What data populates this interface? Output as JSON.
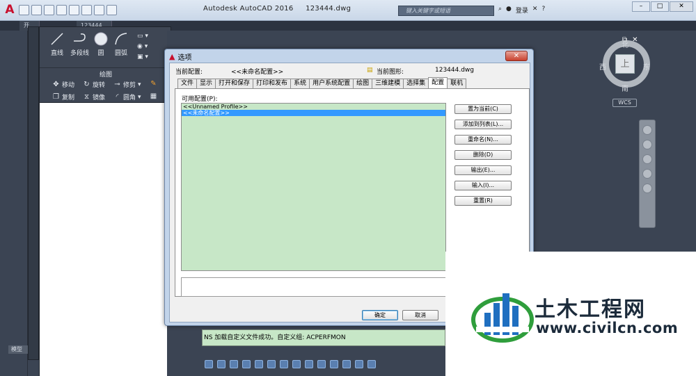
{
  "app": {
    "title_product": "Autodesk AutoCAD 2016",
    "title_file": "123444.dwg",
    "search_placeholder": "键入关键字或短语",
    "login_label": "登录"
  },
  "doc_tabs": [
    {
      "label": "开..."
    },
    {
      "label": "123444..."
    }
  ],
  "left_strip": {
    "model_tab": "模型"
  },
  "ribbon": {
    "draw_tools": [
      {
        "label": "直线"
      },
      {
        "label": "多段线"
      },
      {
        "label": "圆"
      },
      {
        "label": "圆弧"
      }
    ],
    "draw_panel_label": "绘图",
    "modify_tools": [
      {
        "label": "移动"
      },
      {
        "label": "旋转"
      },
      {
        "label": "修剪"
      },
      {
        "label": "复制"
      },
      {
        "label": "镜像"
      },
      {
        "label": "圆角"
      }
    ]
  },
  "view_cube": {
    "top_face": "上",
    "north": "北",
    "south": "南",
    "east": "东",
    "west": "西",
    "wcs_label": "WCS"
  },
  "dialog": {
    "title": "选项",
    "current_profile_label": "当前配置:",
    "current_profile_value": "<<未命名配置>>",
    "current_drawing_label": "当前图形:",
    "current_drawing_value": "123444.dwg",
    "tabs": [
      {
        "label": "文件",
        "active": false
      },
      {
        "label": "显示",
        "active": false
      },
      {
        "label": "打开和保存",
        "active": false
      },
      {
        "label": "打印和发布",
        "active": false
      },
      {
        "label": "系统",
        "active": false
      },
      {
        "label": "用户系统配置",
        "active": false
      },
      {
        "label": "绘图",
        "active": false
      },
      {
        "label": "三维建模",
        "active": false
      },
      {
        "label": "选择集",
        "active": false
      },
      {
        "label": "配置",
        "active": true
      },
      {
        "label": "联机",
        "active": false
      }
    ],
    "available_profiles_label": "可用配置(P):",
    "profiles": [
      {
        "label": "<<Unnamed Profile>>",
        "selected": false
      },
      {
        "label": "<<未命名配置>>",
        "selected": true
      }
    ],
    "side_buttons": [
      {
        "label": "置为当前(C)"
      },
      {
        "label": "添加到列表(L)..."
      },
      {
        "label": "重命名(N)..."
      },
      {
        "label": "删除(D)"
      },
      {
        "label": "输出(E)..."
      },
      {
        "label": "输入(I)..."
      },
      {
        "label": "重置(R)"
      }
    ],
    "ok_label": "确定",
    "cancel_label": "取消"
  },
  "command_line": {
    "text": "NS 加载自定义文件成功。自定义组: ACPERFMON"
  },
  "watermark": {
    "brand_cn": "土木工程网",
    "url": "www.civilcn.com"
  },
  "colors": {
    "accent_red": "#c8102e",
    "list_green": "#c7e7c7",
    "selection_blue": "#3399ff",
    "watermark_blue": "#1f6fc0",
    "watermark_green": "#2f9e3c"
  }
}
